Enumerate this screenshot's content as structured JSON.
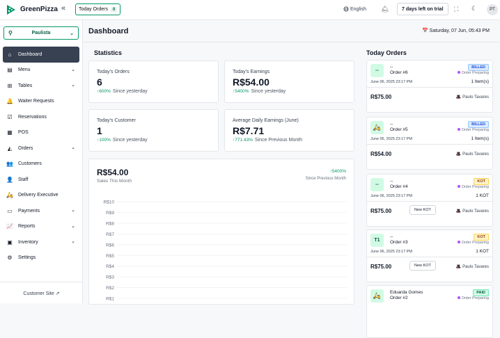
{
  "app": {
    "brand": "GreenPizza",
    "logo_color": "#059669"
  },
  "topbar": {
    "today_orders_label": "Today Orders",
    "today_orders_count": "0",
    "language": "English",
    "trial_label": "7 days left on trial",
    "avatar_initials": "PT"
  },
  "sidebar": {
    "branch": "Paulista",
    "items": [
      {
        "label": "Dashboard",
        "icon": "home-icon",
        "active": true
      },
      {
        "label": "Menu",
        "icon": "menu-book-icon",
        "chevron": true
      },
      {
        "label": "Tables",
        "icon": "table-icon",
        "chevron": true
      },
      {
        "label": "Waiter Requests",
        "icon": "bell-icon"
      },
      {
        "label": "Reservations",
        "icon": "calendar-check-icon"
      },
      {
        "label": "POS",
        "icon": "pos-icon"
      },
      {
        "label": "Orders",
        "icon": "orders-icon",
        "chevron": true
      },
      {
        "label": "Customers",
        "icon": "users-icon"
      },
      {
        "label": "Staff",
        "icon": "staff-icon"
      },
      {
        "label": "Delivery Executive",
        "icon": "bike-icon"
      },
      {
        "label": "Payments",
        "icon": "wallet-icon",
        "chevron": true
      },
      {
        "label": "Reports",
        "icon": "chart-icon",
        "chevron": true
      },
      {
        "label": "Inventory",
        "icon": "inventory-icon",
        "chevron": true
      },
      {
        "label": "Settings",
        "icon": "gear-icon"
      }
    ],
    "customer_site": "Customer Site"
  },
  "main": {
    "title": "Dashboard",
    "datetime": "Saturday, 07 Jun, 05:43 PM",
    "statistics_title": "Statistics",
    "stats": [
      {
        "label": "Today's Orders",
        "value": "6",
        "change": "600%",
        "since": "Since yesterday"
      },
      {
        "label": "Today's Earnings",
        "value": "R$54.00",
        "change": "5400%",
        "since": "Since yesterday"
      },
      {
        "label": "Today's Customer",
        "value": "1",
        "change": "100%",
        "since": "Since yesterday"
      },
      {
        "label": "Average Daily Earnings (June)",
        "value": "R$7.71",
        "change": "771.43%",
        "since": "Since Previous Month"
      }
    ],
    "sales": {
      "value": "R$54.00",
      "subtitle": "Sales This Month",
      "change": "5400%",
      "since": "Since Previous Month"
    }
  },
  "chart_data": {
    "type": "line",
    "ylim": [
      0,
      10
    ],
    "yticks": [
      "R$1",
      "R$2",
      "R$3",
      "R$4",
      "R$5",
      "R$6",
      "R$7",
      "R$8",
      "R$9",
      "R$10"
    ],
    "grid": true
  },
  "today_orders": {
    "title": "Today Orders",
    "orders": [
      {
        "icon_text": "--",
        "name": "--",
        "number": "Order #6",
        "status": "BILLED",
        "prep": "Order Preparing",
        "date": "June 06, 2025 23:17 PM",
        "items": "1 Item(s)",
        "total": "R$75.00",
        "waiter": "Paulo Tavares",
        "new_kot": ""
      },
      {
        "icon_text": "",
        "name": "--",
        "number": "Order #5",
        "status": "BILLED",
        "prep": "Order Preparing",
        "date": "June 06, 2025 23:17 PM",
        "items": "1 Item(s)",
        "total": "R$54.00",
        "waiter": "Paulo Tavares",
        "new_kot": ""
      },
      {
        "icon_text": "--",
        "name": "--",
        "number": "Order #4",
        "status": "KOT",
        "prep": "Order Preparing",
        "date": "June 06, 2025 23:17 PM",
        "items": "1 KOT",
        "total": "R$75.00",
        "waiter": "Paulo Tavares",
        "new_kot": "New KOT"
      },
      {
        "icon_text": "T1",
        "name": "--",
        "number": "Order #3",
        "status": "KOT",
        "prep": "Order Preparing",
        "date": "June 06, 2025 23:17 PM",
        "items": "1 KOT",
        "total": "R$75.00",
        "waiter": "Paulo Tavares",
        "new_kot": "New KOT"
      },
      {
        "icon_text": "",
        "name": "Eduarda Gomes",
        "number": "Order #2",
        "status": "PAID",
        "prep": "Order Preparing",
        "date": "",
        "items": "",
        "total": "",
        "waiter": "",
        "new_kot": ""
      }
    ]
  }
}
